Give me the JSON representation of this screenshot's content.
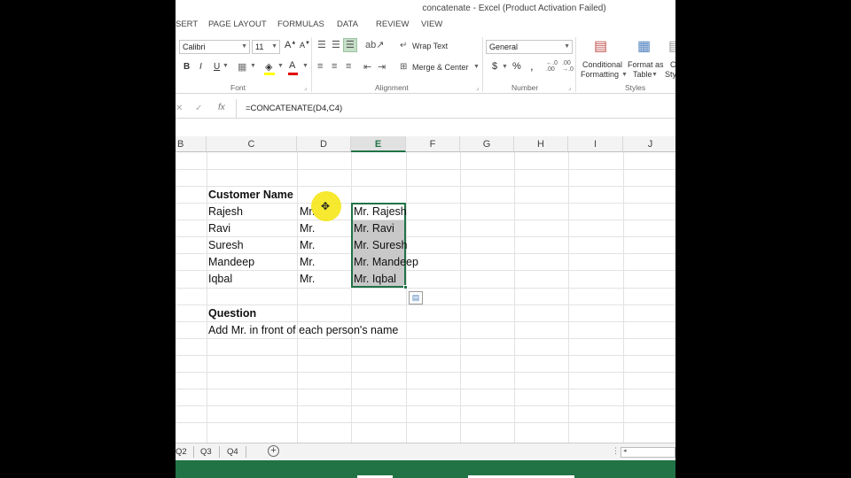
{
  "window": {
    "title": "concatenate - Excel (Product Activation Failed)"
  },
  "tabs": [
    "SERT",
    "PAGE LAYOUT",
    "FORMULAS",
    "DATA",
    "REVIEW",
    "VIEW"
  ],
  "ribbon": {
    "font_name": "Calibri",
    "font_size": "11",
    "bold": "B",
    "italic": "I",
    "underline": "U",
    "wrap_text": "Wrap Text",
    "merge_center": "Merge & Center",
    "number_format": "General",
    "currency": "$",
    "percent": "%",
    "comma": ",",
    "cond_format_1": "Conditional",
    "cond_format_2": "Formatting",
    "format_table_1": "Format as",
    "format_table_2": "Table",
    "cell_styles_1": "C",
    "cell_styles_2": "Sty",
    "group_font": "Font",
    "group_alignment": "Alignment",
    "group_number": "Number",
    "group_styles": "Styles"
  },
  "formula_bar": {
    "fx": "fx",
    "formula": "=CONCATENATE(D4,C4)"
  },
  "columns": [
    "B",
    "C",
    "D",
    "E",
    "F",
    "G",
    "H",
    "I",
    "J"
  ],
  "cells": {
    "header": "Customer Name",
    "names": [
      "Rajesh",
      "Ravi",
      "Suresh",
      "Mandeep",
      "Iqbal"
    ],
    "prefixes": [
      "Mr.",
      "Mr.",
      "Mr.",
      "Mr.",
      "Mr."
    ],
    "results": [
      "Mr. Rajesh",
      "Mr. Ravi",
      "Mr. Suresh",
      "Mr. Mandeep",
      "Mr. Iqbal"
    ],
    "question_label": "Question",
    "question_text": "Add Mr. in front of each person's name"
  },
  "sheet_tabs": [
    "Q2",
    "Q3",
    "Q4"
  ],
  "colors": {
    "excel_green": "#217346",
    "selection_fill": "#c8c8c8",
    "cursor_highlight": "#f5e50a"
  }
}
